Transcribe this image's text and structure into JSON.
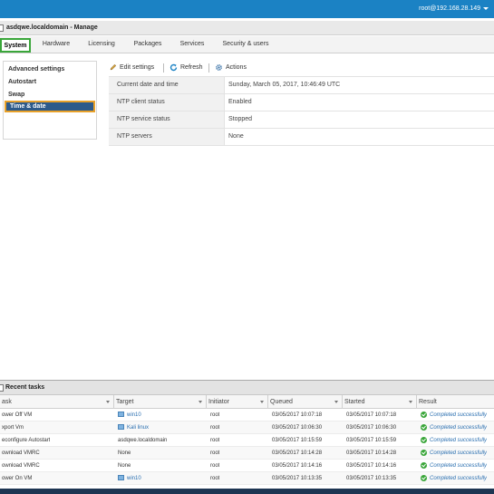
{
  "header": {
    "user": "root@192.168.28.149"
  },
  "window": {
    "title": "asdqwe.localdomain - Manage"
  },
  "tabs": [
    {
      "label": "System",
      "active": true
    },
    {
      "label": "Hardware"
    },
    {
      "label": "Licensing"
    },
    {
      "label": "Packages"
    },
    {
      "label": "Services"
    },
    {
      "label": "Security & users"
    }
  ],
  "sidebar": {
    "items": [
      {
        "label": "Advanced settings"
      },
      {
        "label": "Autostart"
      },
      {
        "label": "Swap"
      },
      {
        "label": "Time & date",
        "active": true
      }
    ]
  },
  "toolbar": {
    "edit_label": "Edit settings",
    "refresh_label": "Refresh",
    "actions_label": "Actions"
  },
  "details": [
    {
      "key": "Current date and time",
      "value": "Sunday, March 05, 2017, 10:46:49 UTC"
    },
    {
      "key": "NTP client status",
      "value": "Enabled"
    },
    {
      "key": "NTP service status",
      "value": "Stopped"
    },
    {
      "key": "NTP servers",
      "value": "None"
    }
  ],
  "recent_tasks": {
    "title": "Recent tasks",
    "columns": [
      "ask",
      "Target",
      "Initiator",
      "Queued",
      "Started",
      "Result"
    ],
    "rows": [
      {
        "task": "ower Off VM",
        "target": "win10",
        "target_vm": true,
        "initiator": "root",
        "queued": "03/05/2017 10:07:18",
        "started": "03/05/2017 10:07:18",
        "result": "Completed successfully"
      },
      {
        "task": "xport Vm",
        "target": "Kali linux",
        "target_vm": true,
        "initiator": "root",
        "queued": "03/05/2017 10:06:30",
        "started": "03/05/2017 10:06:30",
        "result": "Completed successfully"
      },
      {
        "task": "econfigure Autostart",
        "target": "asdqwe.localdomain",
        "target_vm": false,
        "initiator": "root",
        "queued": "03/05/2017 10:15:59",
        "started": "03/05/2017 10:15:59",
        "result": "Completed successfully"
      },
      {
        "task": "ownload VMRC",
        "target": "None",
        "target_vm": false,
        "initiator": "root",
        "queued": "03/05/2017 10:14:28",
        "started": "03/05/2017 10:14:28",
        "result": "Completed successfully"
      },
      {
        "task": "ownload VMRC",
        "target": "None",
        "target_vm": false,
        "initiator": "root",
        "queued": "03/05/2017 10:14:16",
        "started": "03/05/2017 10:14:16",
        "result": "Completed successfully"
      },
      {
        "task": "ower On VM",
        "target": "win10",
        "target_vm": true,
        "initiator": "root",
        "queued": "03/05/2017 10:13:35",
        "started": "03/05/2017 10:13:35",
        "result": "Completed successfully"
      }
    ]
  },
  "colors": {
    "accent": "#1b82c4",
    "tab_highlight": "#3aa63a",
    "nav_highlight": "#e8a12a",
    "nav_active_bg": "#2d5a8a"
  }
}
